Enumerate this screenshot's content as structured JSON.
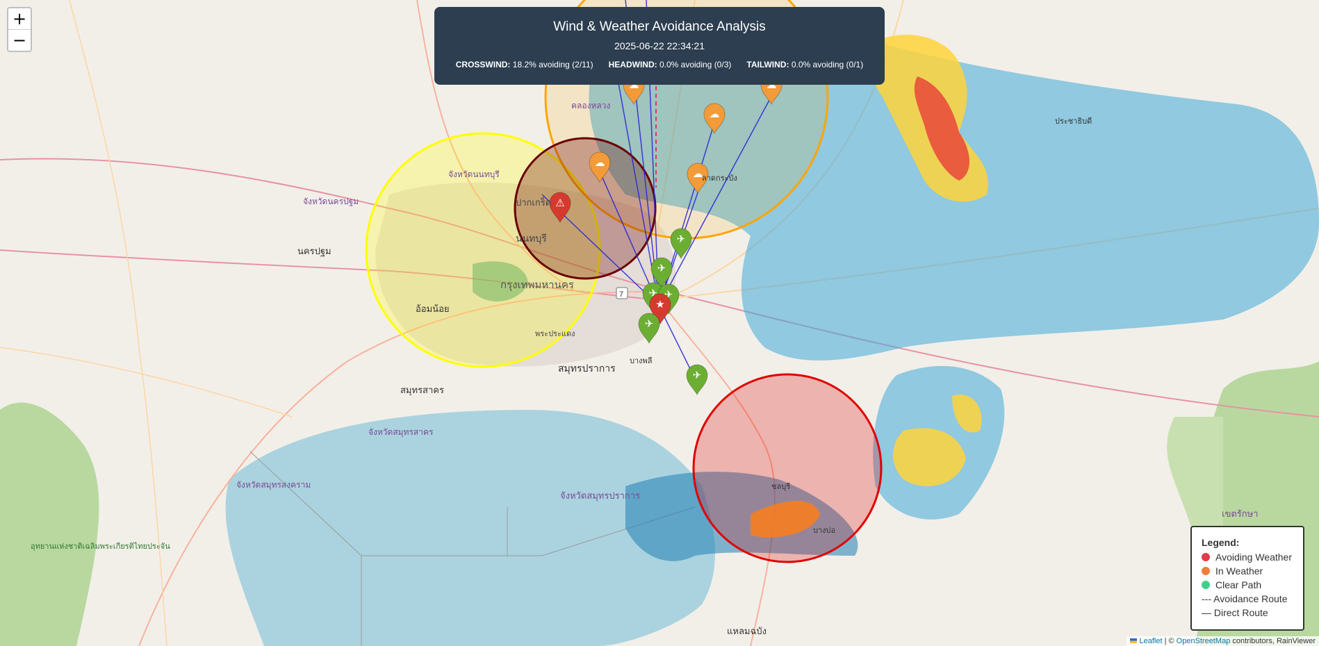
{
  "header": {
    "title": "Wind & Weather Avoidance Analysis",
    "timestamp": "2025-06-22 22:34:21",
    "stats": [
      {
        "label": "CROSSWIND:",
        "value": "18.2% avoiding (2/11)"
      },
      {
        "label": "HEADWIND:",
        "value": "0.0% avoiding (0/3)"
      },
      {
        "label": "TAILWIND:",
        "value": "0.0% avoiding (0/1)"
      }
    ]
  },
  "zoom": {
    "in": "+",
    "out": "−"
  },
  "legend": {
    "title": "Legend:",
    "items": [
      {
        "label": "Avoiding Weather",
        "color": "#e03a4c"
      },
      {
        "label": "In Weather",
        "color": "#f07e3a"
      },
      {
        "label": "Clear Path",
        "color": "#3fcf8a"
      }
    ],
    "avoidance_route": "--- Avoidance Route",
    "direct_route": "— Direct Route"
  },
  "attribution": {
    "leaflet": "Leaflet",
    "sep": " | © ",
    "osm": "OpenStreetMap",
    "rest": " contributors, RainViewer"
  },
  "map_labels": {
    "bangkok": "กรุงเทพมหานคร",
    "nonthaburi": "นนทบุรี",
    "pak_kret": "ปากเกร็ด",
    "samut_prakan": "สมุทรปราการ",
    "samut_sakhon": "สมุทรสาคร",
    "nakhon_pathom": "นครปฐม",
    "prov_nonthaburi": "จังหวัดนนทบุรี",
    "prov_nakhon_pathom": "จังหวัดนครปฐม",
    "prov_samut_sakhon": "จังหวัดสมุทรสาคร",
    "prov_samut_songkhram": "จังหวัดสมุทรสงคราม",
    "prov_samut_prakan": "จังหวัดสมุทรปราการ",
    "om_noi": "อ้อมน้อย",
    "phra_pradaeng": "พระประแดง",
    "chachoengsao": "เขตรักษา",
    "laem_chabang": "แหลมฉบัง",
    "chonburi": "ชลบุรี",
    "bang_bo": "บางบ่อ",
    "prachinburi_east": "ประชาธิบดี",
    "bang_phli": "บางพลี",
    "lat_krabang": "ลาดกระบัง",
    "khlong_luang": "คลองหลวง",
    "park": "อุทยานแห่งชาติเฉลิมพระเกียรติไทยประจัน",
    "highway": "7"
  },
  "colors": {
    "yellow_zone": "#ffff00",
    "dark_red_zone": "#6b0000",
    "orange_zone": "#ffa500",
    "red_zone": "#e00000",
    "route": "#2323d6",
    "clear_marker": "#6cae33",
    "weather_marker": "#f29b38",
    "avoid_marker": "#d63a2f",
    "sea": "#aad3df",
    "rain_blue": "#3fa9d9",
    "rain_yellow": "#ffd43b",
    "rain_red": "#e8483a"
  }
}
